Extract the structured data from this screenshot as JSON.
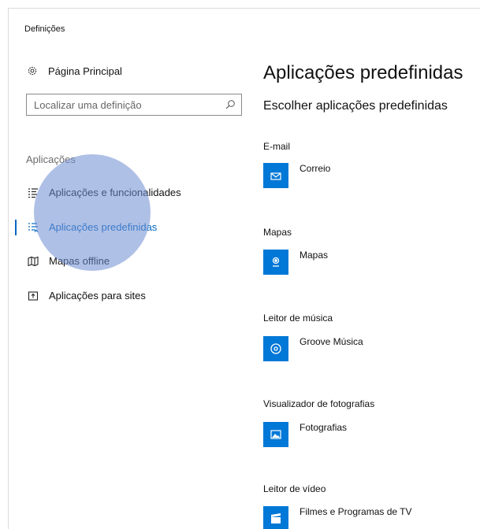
{
  "window": {
    "title": "Definições"
  },
  "sidebar": {
    "home_label": "Página Principal",
    "search_placeholder": "Localizar uma definição",
    "section_label": "Aplicações",
    "items": [
      {
        "label": "Aplicações e funcionalidades",
        "icon": "list-icon",
        "active": false
      },
      {
        "label": "Aplicações predefinidas",
        "icon": "default-apps-icon",
        "active": true
      },
      {
        "label": "Mapas offline",
        "icon": "map-icon",
        "active": false
      },
      {
        "label": "Aplicações para sites",
        "icon": "link-window-icon",
        "active": false
      }
    ]
  },
  "main": {
    "title": "Aplicações predefinidas",
    "subtitle": "Escolher aplicações predefinidas",
    "categories": [
      {
        "label": "E-mail",
        "app": "Correio",
        "icon": "mail-icon"
      },
      {
        "label": "Mapas",
        "app": "Mapas",
        "icon": "map-pin-icon"
      },
      {
        "label": "Leitor de música",
        "app": "Groove Música",
        "icon": "music-disc-icon"
      },
      {
        "label": "Visualizador de fotografias",
        "app": "Fotografias",
        "icon": "photo-icon"
      },
      {
        "label": "Leitor de vídeo",
        "app": "Filmes e Programas de TV",
        "icon": "film-icon"
      }
    ]
  },
  "colors": {
    "accent": "#0078d7",
    "active_text": "#0067c0",
    "highlight": "#6e8cd2"
  }
}
